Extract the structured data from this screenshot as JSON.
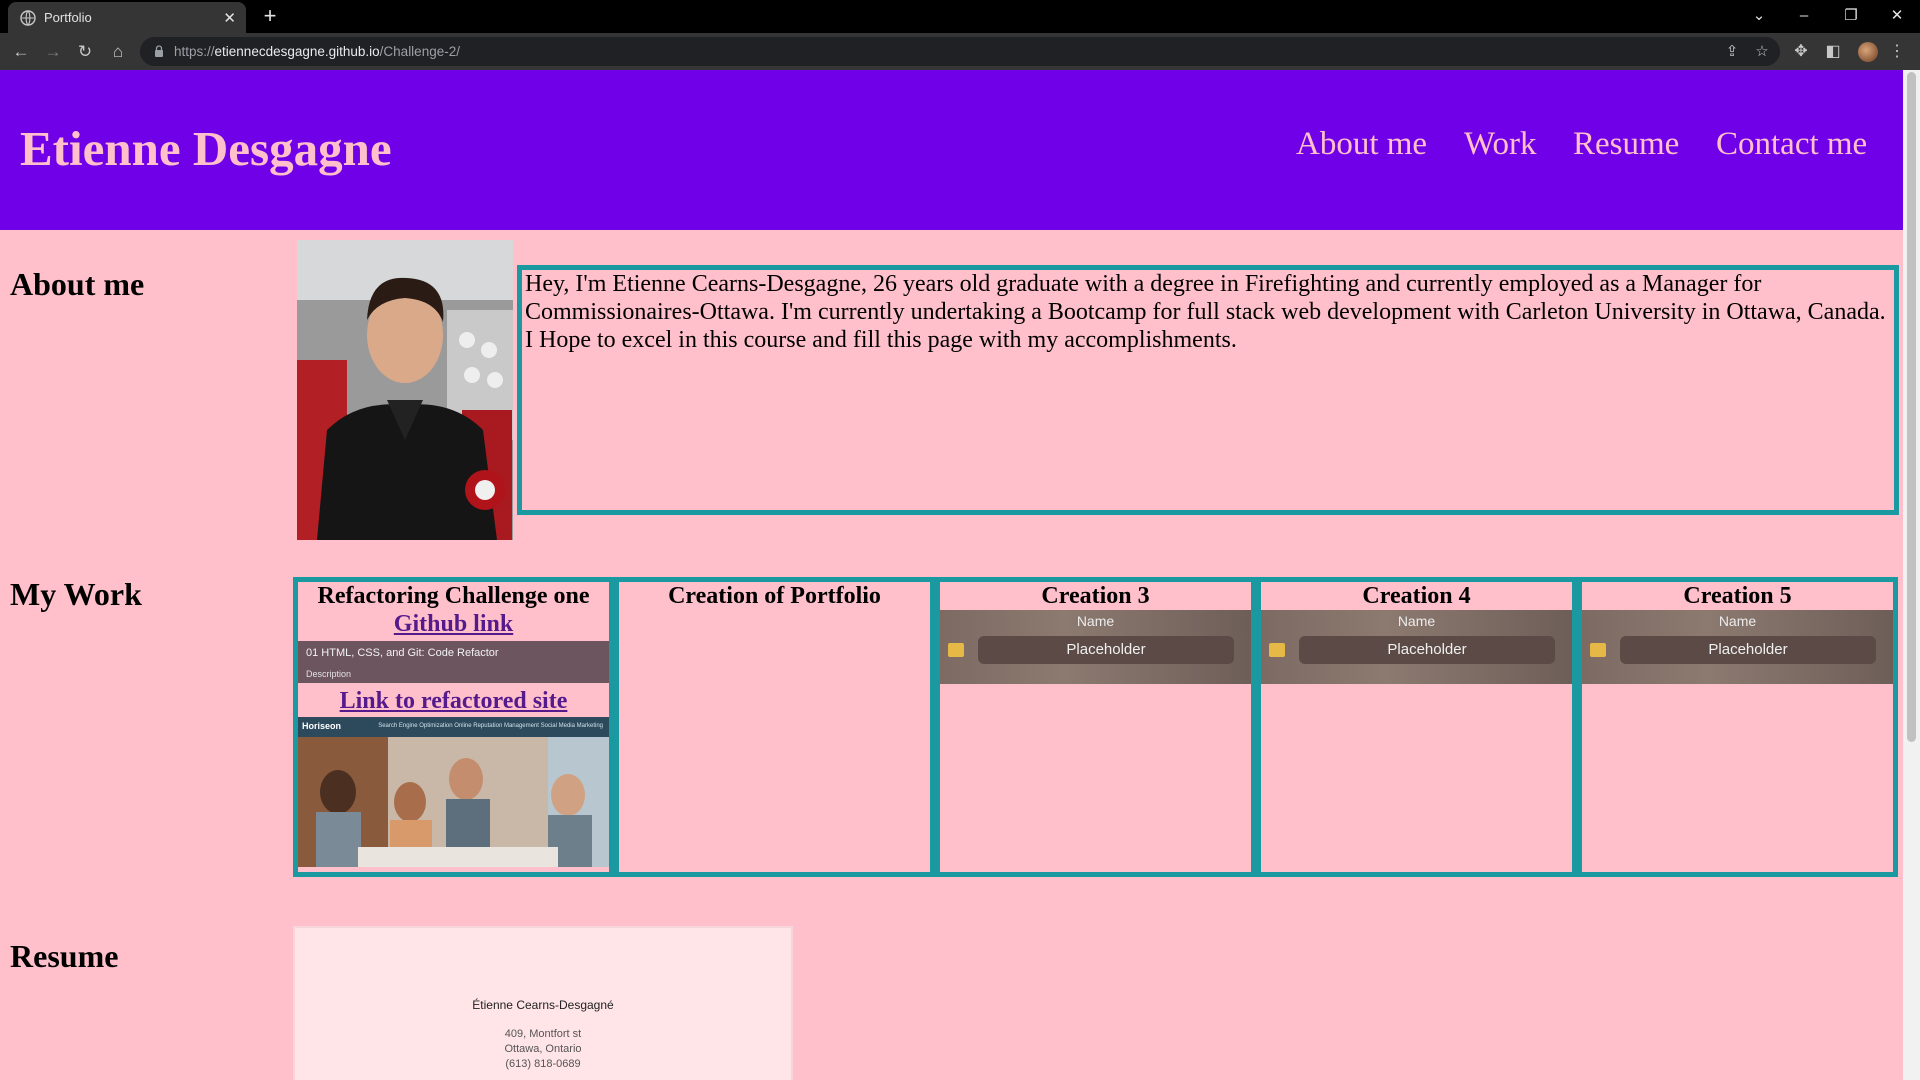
{
  "browser": {
    "tab_title": "Portfolio",
    "tab_close": "✕",
    "new_tab": "+",
    "url_prefix": "https://",
    "url_host": "etiennecdesgagne.github.io",
    "url_path": "/Challenge-2/"
  },
  "header": {
    "title": "Etienne Desgagne",
    "nav": [
      "About me",
      "Work",
      "Resume",
      "Contact me"
    ]
  },
  "about": {
    "heading": "About me",
    "text": "Hey, I'm Etienne Cearns-Desgagne, 26 years old graduate with a degree in Firefighting and currently employed as a Manager for Commissionaires-Ottawa. I'm currently undertaking a Bootcamp for full stack web development with Carleton University in Ottawa, Canada. I Hope to excel in this course and fill this page with my accomplishments."
  },
  "work": {
    "heading": "My Work",
    "cards": [
      {
        "title": "Refactoring Challenge one",
        "link1": "Github link",
        "banner_title": "01 HTML, CSS, and Git: Code Refactor",
        "banner_desc": "Description",
        "link2": "Link to refactored site",
        "shot_logo": "Horiseon",
        "shot_links": "Search Engine Optimization    Online Reputation Management    Social Media Marketing"
      },
      {
        "title": "Creation of Portfolio"
      },
      {
        "title": "Creation 3",
        "ph_name": "Name",
        "ph_field": "Placeholder"
      },
      {
        "title": "Creation 4",
        "ph_name": "Name",
        "ph_field": "Placeholder"
      },
      {
        "title": "Creation 5",
        "ph_name": "Name",
        "ph_field": "Placeholder"
      }
    ]
  },
  "resume": {
    "heading": "Resume",
    "name": "Étienne Cearns-Desgagné",
    "lines": [
      "409, Montfort st",
      "Ottawa, Ontario",
      "(613) 818-0689"
    ]
  },
  "colors": {
    "header_bg": "#7000e8",
    "page_bg": "#ffc0cb",
    "accent_border": "#1a9aa0",
    "link": "#551a8b"
  }
}
